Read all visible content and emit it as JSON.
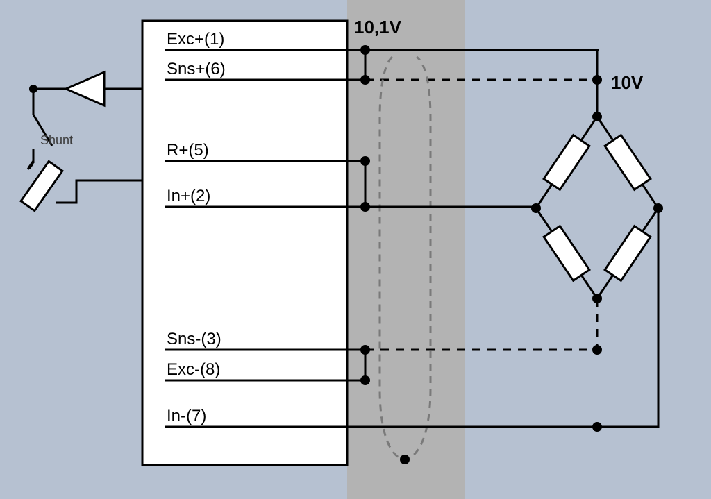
{
  "pins": {
    "exc_plus": "Exc+(1)",
    "sns_plus": "Sns+(6)",
    "r_plus": "R+(5)",
    "in_plus": "In+(2)",
    "sns_minus": "Sns-(3)",
    "exc_minus": "Exc-(8)",
    "in_minus": "In-(7)"
  },
  "voltages": {
    "v_driver": "10,1V",
    "v_sense": "10V"
  },
  "shunt_label": "Shunt"
}
